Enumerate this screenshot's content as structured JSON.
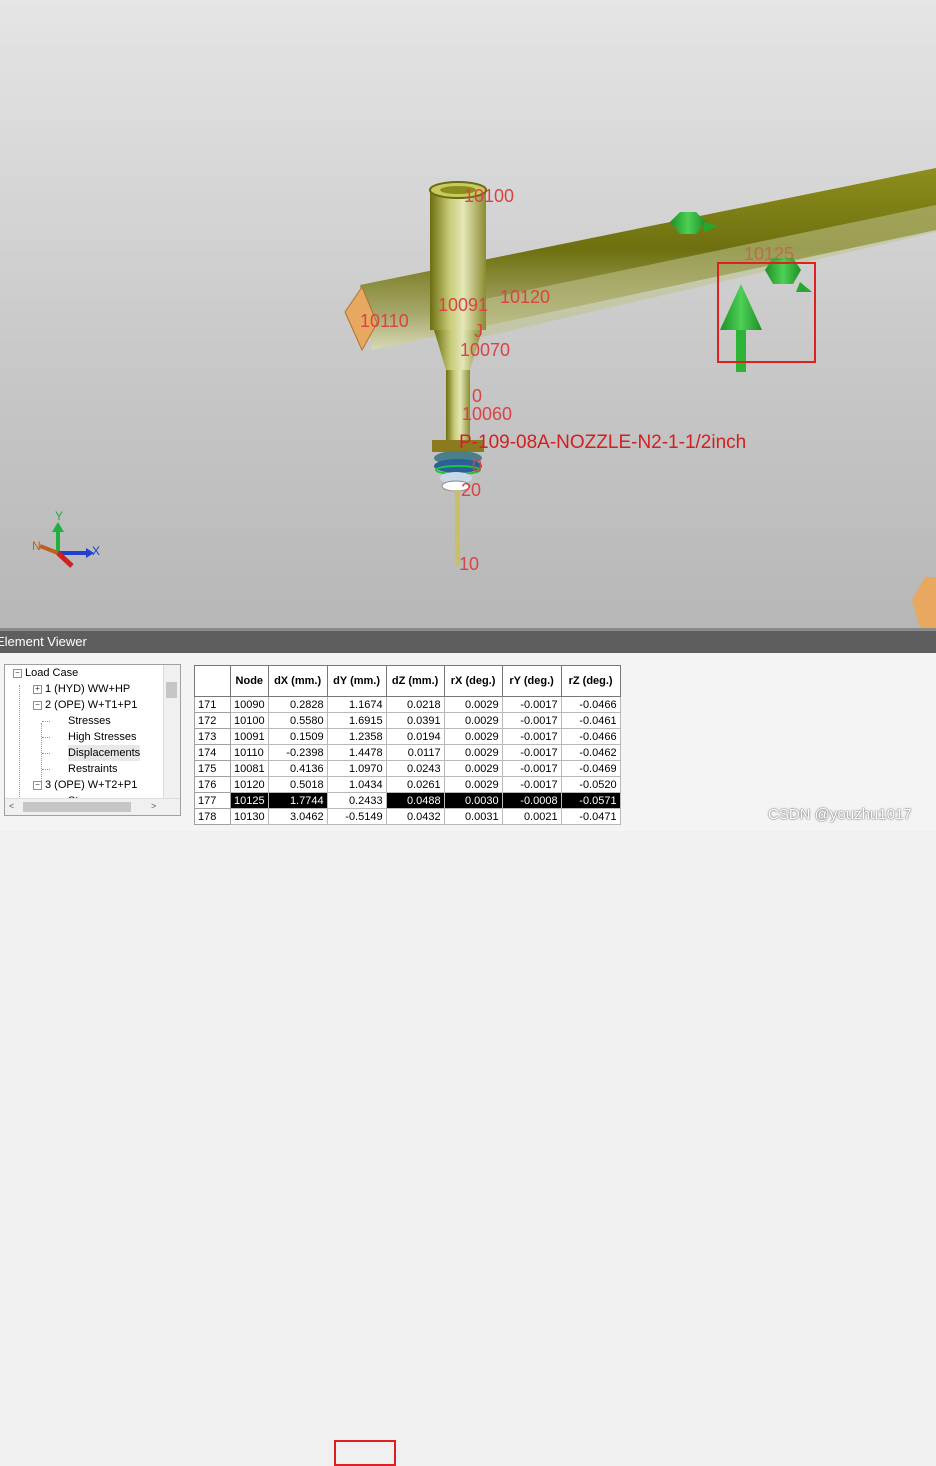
{
  "viewport": {
    "node_labels": [
      "10100",
      "10110",
      "10091",
      "10120",
      "10070",
      "10060",
      "10",
      "20",
      "0",
      "0",
      "J",
      "10125"
    ],
    "tag_label": "P-109-08A-NOZZLE-N2-1-1/2inch",
    "axis": {
      "x": "X",
      "y": "Y",
      "n": "N"
    }
  },
  "panel": {
    "title": "Element Viewer"
  },
  "tree": {
    "root": "Load Case",
    "items": [
      {
        "label": "1 (HYD) WW+HP",
        "expander": "+"
      },
      {
        "label": "2 (OPE) W+T1+P1",
        "expander": "−"
      },
      {
        "label": "Stresses"
      },
      {
        "label": "High Stresses"
      },
      {
        "label": "Displacements"
      },
      {
        "label": "Restraints"
      },
      {
        "label": "3 (OPE) W+T2+P1",
        "expander": "−"
      },
      {
        "label": "Stresses"
      }
    ],
    "scroll_left": "<",
    "scroll_right": ">"
  },
  "table": {
    "headers": [
      "",
      "Node",
      "dX (mm.)",
      "dY (mm.)",
      "dZ (mm.)",
      "rX (deg.)",
      "rY (deg.)",
      "rZ (deg.)"
    ],
    "rows": [
      [
        "171",
        "10090",
        "0.2828",
        "1.1674",
        "0.0218",
        "0.0029",
        "-0.0017",
        "-0.0466"
      ],
      [
        "172",
        "10100",
        "0.5580",
        "1.6915",
        "0.0391",
        "0.0029",
        "-0.0017",
        "-0.0461"
      ],
      [
        "173",
        "10091",
        "0.1509",
        "1.2358",
        "0.0194",
        "0.0029",
        "-0.0017",
        "-0.0466"
      ],
      [
        "174",
        "10110",
        "-0.2398",
        "1.4478",
        "0.0117",
        "0.0029",
        "-0.0017",
        "-0.0462"
      ],
      [
        "175",
        "10081",
        "0.4136",
        "1.0970",
        "0.0243",
        "0.0029",
        "-0.0017",
        "-0.0469"
      ],
      [
        "176",
        "10120",
        "0.5018",
        "1.0434",
        "0.0261",
        "0.0029",
        "-0.0017",
        "-0.0520"
      ],
      [
        "177",
        "10125",
        "1.7744",
        "0.2433",
        "0.0488",
        "0.0030",
        "-0.0008",
        "-0.0571"
      ],
      [
        "178",
        "10130",
        "3.0462",
        "-0.5149",
        "0.0432",
        "0.0031",
        "0.0021",
        "-0.0471"
      ]
    ],
    "selected_row_index": 6
  },
  "watermark": "CSDN @youzhu1017",
  "colors": {
    "pipe": "#7a7a10",
    "pipe_light": "#c8cc70",
    "restraint": "#28b030",
    "label_red": "#d84444",
    "highlight_box": "#e02020"
  }
}
